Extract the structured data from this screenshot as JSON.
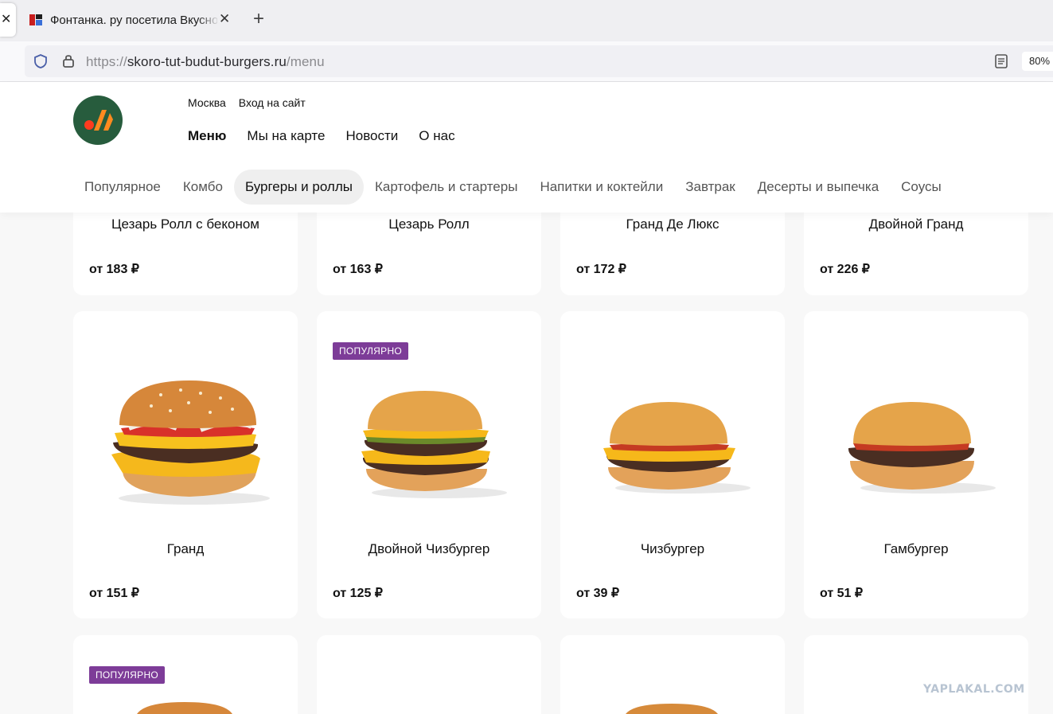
{
  "browser": {
    "tab_title": "Фонтанка. ру посетила Вкусно",
    "url_scheme": "https://",
    "url_host": "skoro-tut-budut-burgers.ru",
    "url_path": "/menu",
    "zoom": "80%"
  },
  "header": {
    "city": "Москва",
    "login": "Вход на сайт",
    "nav": [
      "Меню",
      "Мы на карте",
      "Новости",
      "О нас"
    ],
    "categories": [
      "Популярное",
      "Комбо",
      "Бургеры и роллы",
      "Картофель и стартеры",
      "Напитки и коктейли",
      "Завтрак",
      "Десерты и выпечка",
      "Соусы"
    ]
  },
  "products_row1": [
    {
      "name": "Цезарь Ролл с беконом",
      "price": "от 183 ₽"
    },
    {
      "name": "Цезарь Ролл",
      "price": "от 163 ₽"
    },
    {
      "name": "Гранд Де Люкс",
      "price": "от 172 ₽"
    },
    {
      "name": "Двойной Гранд",
      "price": "от 226 ₽"
    }
  ],
  "products_row2": [
    {
      "name": "Гранд",
      "price": "от 151 ₽"
    },
    {
      "name": "Двойной Чизбургер",
      "price": "от 125 ₽",
      "badge": "ПОПУЛЯРНО"
    },
    {
      "name": "Чизбургер",
      "price": "от 39 ₽"
    },
    {
      "name": "Гамбургер",
      "price": "от 51 ₽"
    }
  ],
  "products_row3": [
    {
      "badge": "ПОПУЛЯРНО"
    }
  ],
  "watermark": "YAPLAKAL.COM",
  "colors": {
    "logo_bg": "#275c3d",
    "badge": "#7d3c98",
    "logo_orange": "#ff8a1f",
    "logo_dot": "#ff3b1f"
  }
}
